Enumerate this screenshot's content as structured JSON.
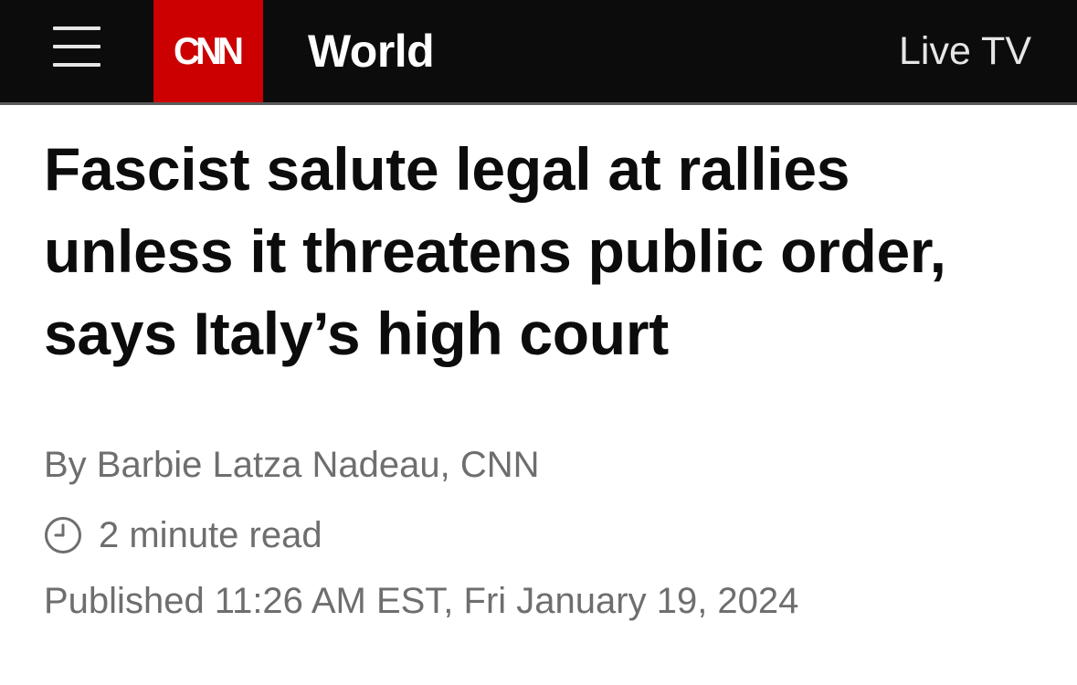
{
  "header": {
    "menu_icon": "hamburger-menu-icon",
    "logo_text": "CNN",
    "section": "World",
    "live_tv_label": "Live TV",
    "colors": {
      "bar_background": "#0c0c0c",
      "logo_background": "#cc0000",
      "text": "#ffffff"
    }
  },
  "article": {
    "headline": "Fascist salute legal at rallies unless it threatens public order, says Italy’s high court",
    "byline_prefix": "By ",
    "author": "Barbie Latza Nadeau, CNN",
    "read_time_icon": "clock-icon",
    "read_time": "2 minute read",
    "published": "Published 11:26 AM EST, Fri January 19, 2024"
  }
}
